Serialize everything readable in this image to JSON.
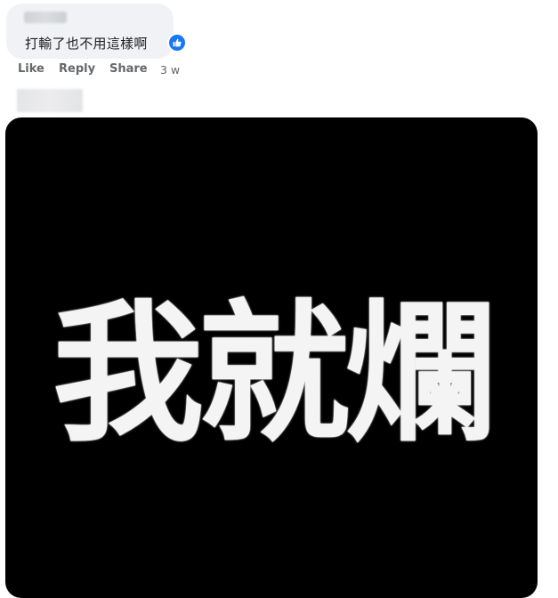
{
  "comment": {
    "text": "打輸了也不用這樣啊",
    "reaction_icon": "like-icon",
    "reaction_color": "#1877f2"
  },
  "actions": {
    "like": "Like",
    "reply": "Reply",
    "share": "Share",
    "timestamp": "3 w"
  },
  "reply": {
    "meme_text": "我就爛"
  },
  "colors": {
    "bubble": "#f0f2f5",
    "action_text": "#65676b",
    "meme_background": "#000000"
  }
}
